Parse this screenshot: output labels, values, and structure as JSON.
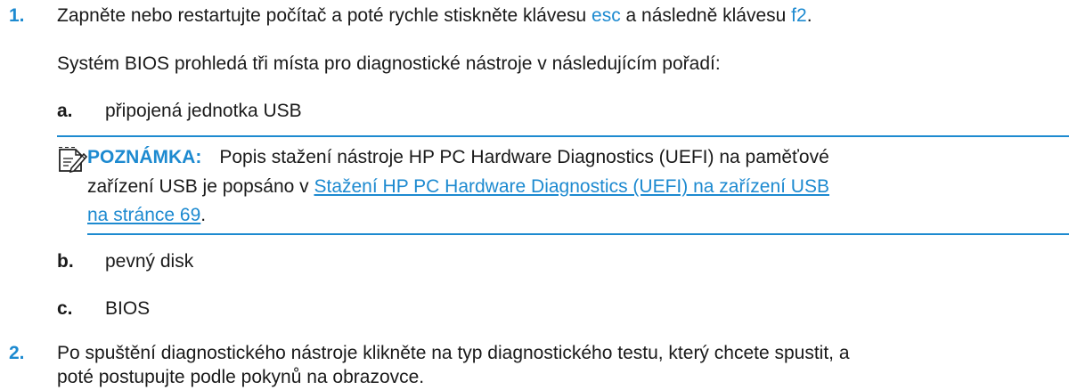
{
  "step1": {
    "number": "1.",
    "text_before": "Zapněte nebo restartujte počítač a poté rychle stiskněte klávesu ",
    "key_esc": "esc",
    "text_middle": " a následně klávesu ",
    "key_f2": "f2",
    "text_after": ".",
    "para": "Systém BIOS prohledá tři místa pro diagnostické nástroje v následujícím pořadí:",
    "items": [
      {
        "letter": "a.",
        "text": "připojená jednotka USB"
      },
      {
        "letter": "b.",
        "text": "pevný disk"
      },
      {
        "letter": "c.",
        "text": "BIOS"
      }
    ]
  },
  "note": {
    "icon": "note-pencil-icon",
    "label": "POZNÁMKA:",
    "text_line1": "Popis stažení nástroje HP PC Hardware Diagnostics (UEFI) na paměťové",
    "text_line2_before": "zařízení USB je popsáno v ",
    "link_line2": "Stažení HP PC Hardware Diagnostics (UEFI) na zařízení USB",
    "link_line3": "na stránce 69",
    "text_line3_after": ".",
    "accent_color": "#1d8ad0"
  },
  "step2": {
    "number": "2.",
    "line1": "Po spuštění diagnostického nástroje klikněte na typ diagnostického testu, který chcete spustit, a",
    "line2": "poté postupujte podle pokynů na obrazovce."
  }
}
